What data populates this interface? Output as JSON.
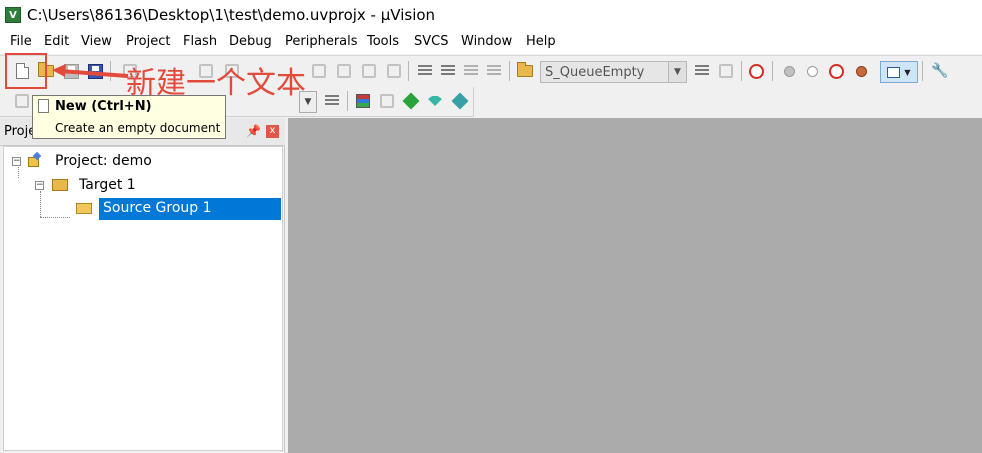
{
  "window": {
    "title": "C:\\Users\\86136\\Desktop\\1\\test\\demo.uvprojx - μVision",
    "app_icon_label": "V"
  },
  "menu": [
    "File",
    "Edit",
    "View",
    "Project",
    "Flash",
    "Debug",
    "Peripherals",
    "Tools",
    "SVCS",
    "Window",
    "Help"
  ],
  "toolbar": {
    "function_combo_value": "S_QueueEmpty",
    "icons": [
      "new-file-icon",
      "open-folder-icon",
      "save-icon",
      "save-all-icon",
      "cut-icon",
      "copy-icon",
      "paste-icon",
      "undo-icon",
      "redo-icon",
      "bookmark-icon",
      "indent-icon",
      "outdent-icon",
      "comment-icon",
      "uncomment-icon",
      "find-in-files-icon",
      "debug-icon",
      "breakpoint-icon",
      "configure-icon"
    ]
  },
  "annotation": {
    "text": "新建一个文本",
    "color": "#e24b3b"
  },
  "tooltip": {
    "title": "New (Ctrl+N)",
    "description": "Create an empty document"
  },
  "project_panel": {
    "title": "Proje",
    "pin_glyph": "📌",
    "close_glyph": "x",
    "tree": [
      {
        "label": "Project: demo",
        "toggle": "−"
      },
      {
        "label": "Target 1",
        "toggle": "−"
      },
      {
        "label": "Source Group 1",
        "selected": true
      }
    ]
  },
  "colors": {
    "selection": "#0078d7",
    "editor_background": "#ababab",
    "tooltip_background": "#ffffe1"
  }
}
